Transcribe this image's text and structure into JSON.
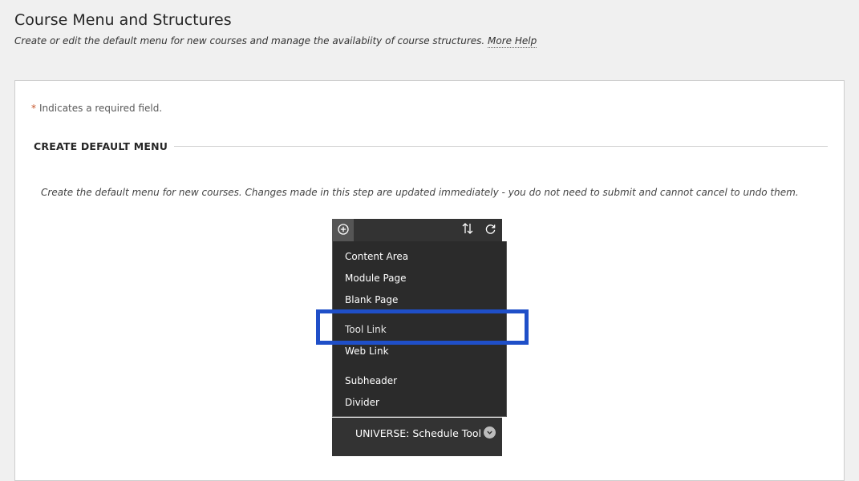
{
  "header": {
    "title": "Course Menu and Structures",
    "description": "Create or edit the default menu for new courses and manage the availabiity of course structures.",
    "more_help": "More Help"
  },
  "form": {
    "required_star": "*",
    "required_note": "Indicates a required field.",
    "section_heading": "CREATE DEFAULT MENU",
    "instructions": "Create the default menu for new courses. Changes made in this step are updated immediately - you do not need to submit and cannot cancel to undo them."
  },
  "menu_toolbar": {
    "icons": [
      "add-menu-item-icon",
      "reorder-icon",
      "refresh-icon"
    ]
  },
  "add_menu": {
    "items": [
      {
        "label": "Content Area"
      },
      {
        "label": "Module Page"
      },
      {
        "label": "Blank Page"
      },
      {
        "label": "Tool Link"
      },
      {
        "label": "Web Link"
      },
      {
        "label": "Subheader"
      },
      {
        "label": "Divider"
      }
    ],
    "highlighted_item": "Tool Link",
    "highlight_color": "#1f4fc8"
  },
  "course_menu": {
    "entries": [
      {
        "label": "UNIVERSE: Schedule Tool",
        "icon": "chevron-down-icon"
      }
    ]
  }
}
